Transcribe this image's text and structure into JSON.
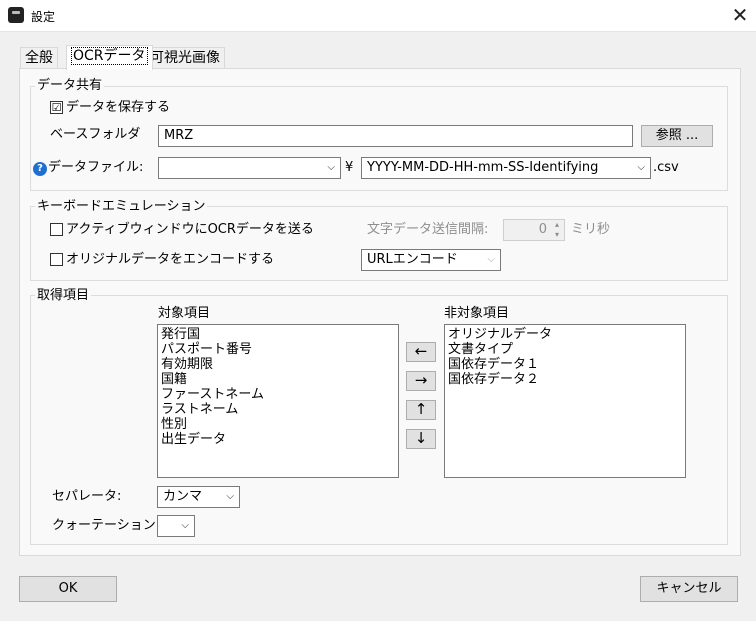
{
  "window": {
    "title": "設定",
    "close_glyph": "✕"
  },
  "tabs": [
    {
      "label": "全般"
    },
    {
      "label": "OCRデータ"
    },
    {
      "label": "可視光画像"
    }
  ],
  "data_sharing": {
    "legend": "データ共有",
    "save_checkbox": {
      "label": "データを保存する",
      "checked": true,
      "glyph": "☑"
    },
    "base_folder": {
      "label": "ベースフォルダ",
      "value": "MRZ",
      "browse_label": "参照 ..."
    },
    "data_file": {
      "label": "データファイル:",
      "help_glyph": "?",
      "prefix_value": "",
      "separator": "¥",
      "name_value": "YYYY-MM-DD-HH-mm-SS-Identifying",
      "extension": ".csv"
    }
  },
  "keyboard": {
    "legend": "キーボードエミュレーション",
    "send_checkbox": {
      "label": "アクティブウィンドウにOCRデータを送る",
      "checked": false
    },
    "interval_label": "文字データ送信間隔:",
    "interval_value": "0",
    "interval_unit": "ミリ秒",
    "encode_checkbox": {
      "label": "オリジナルデータをエンコードする",
      "checked": false
    },
    "encoding_value": "URLエンコード"
  },
  "fields": {
    "legend": "取得項目",
    "target_header": "対象項目",
    "nontarget_header": "非対象項目",
    "target_items": [
      "発行国",
      "パスポート番号",
      "有効期限",
      "国籍",
      "ファーストネーム",
      "ラストネーム",
      "性別",
      "出生データ"
    ],
    "nontarget_items": [
      "オリジナルデータ",
      "文書タイプ",
      "国依存データ１",
      "国依存データ２"
    ],
    "move_left": "←",
    "move_right": "→",
    "move_up": "↑",
    "move_down": "↓",
    "separator_label": "セパレータ:",
    "separator_value": "カンマ",
    "quotation_label": "クォーテーション:",
    "quotation_value": ""
  },
  "dropdown_arrow": "⌵",
  "spin_up": "▴",
  "spin_down": "▾",
  "footer": {
    "ok_label": "OK",
    "cancel_label": "キャンセル"
  },
  "colors": {
    "help_icon": "#1f6fd1",
    "background": "#f0f0f0",
    "panel": "#f9f9f9"
  }
}
